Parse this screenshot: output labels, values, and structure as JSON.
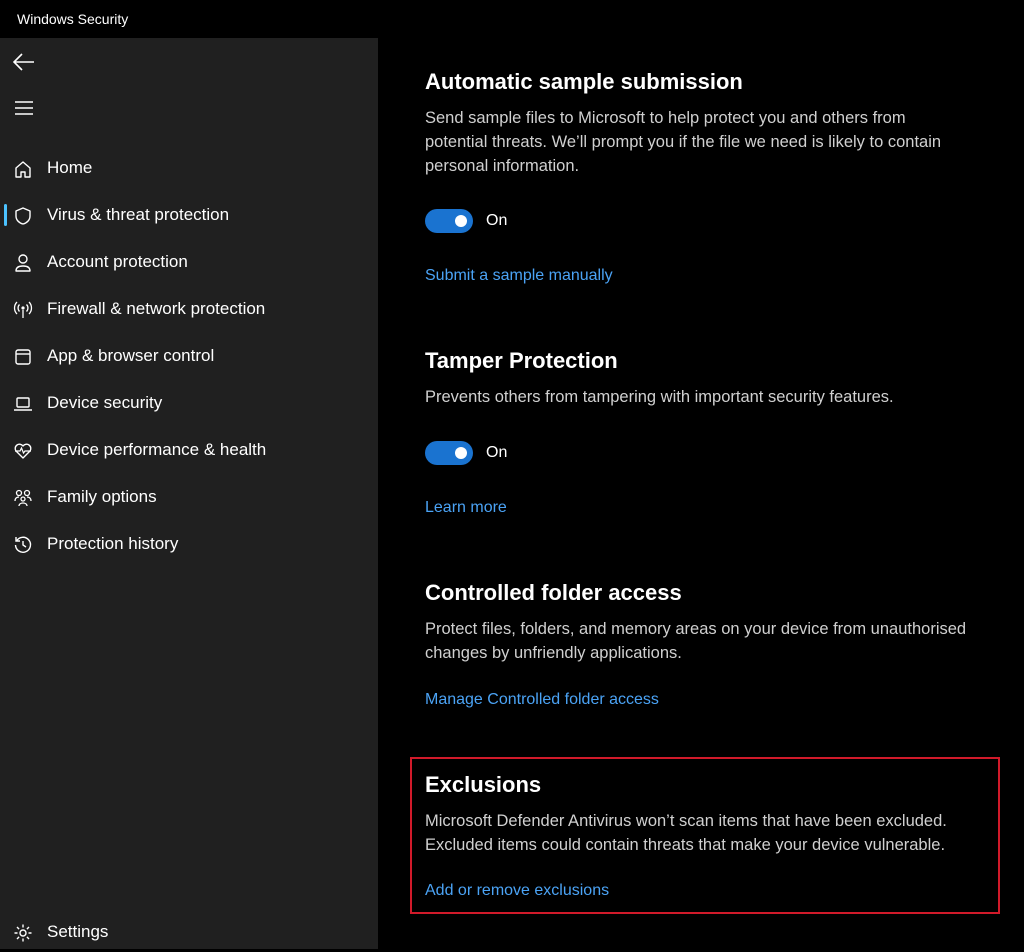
{
  "window": {
    "title": "Windows Security"
  },
  "sidebar": {
    "items": [
      {
        "label": "Home",
        "icon": "home-icon"
      },
      {
        "label": "Virus & threat protection",
        "icon": "shield-icon",
        "selected": true
      },
      {
        "label": "Account protection",
        "icon": "person-icon"
      },
      {
        "label": "Firewall & network protection",
        "icon": "antenna-icon"
      },
      {
        "label": "App & browser control",
        "icon": "app-window-icon"
      },
      {
        "label": "Device security",
        "icon": "laptop-icon"
      },
      {
        "label": "Device performance & health",
        "icon": "heart-pulse-icon"
      },
      {
        "label": "Family options",
        "icon": "family-icon"
      },
      {
        "label": "Protection history",
        "icon": "history-icon"
      }
    ],
    "settings_label": "Settings"
  },
  "sections": {
    "sample": {
      "title": "Automatic sample submission",
      "desc_lines": [
        "Send sample files to Microsoft to help protect you and others from",
        "potential threats. We’ll prompt you if the file we need is likely to contain",
        "personal information."
      ],
      "toggle_state": "On",
      "link": "Submit a sample manually"
    },
    "tamper": {
      "title": "Tamper Protection",
      "desc_lines": [
        "Prevents others from tampering with important security features."
      ],
      "toggle_state": "On",
      "link": "Learn more"
    },
    "cfa": {
      "title": "Controlled folder access",
      "desc_lines": [
        "Protect files, folders, and memory areas on your device from unauthorised",
        "changes by unfriendly applications."
      ],
      "link": "Manage Controlled folder access"
    },
    "exclusions": {
      "title": "Exclusions",
      "desc_lines": [
        "Microsoft Defender Antivirus won’t scan items that have been excluded.",
        "Excluded items could contain threats that make your device vulnerable."
      ],
      "link": "Add or remove exclusions"
    }
  },
  "colors": {
    "accent": "#4cc2ff",
    "toggle_on": "#1a73d0",
    "link": "#4ba3f5",
    "highlight": "#d11a2a"
  }
}
